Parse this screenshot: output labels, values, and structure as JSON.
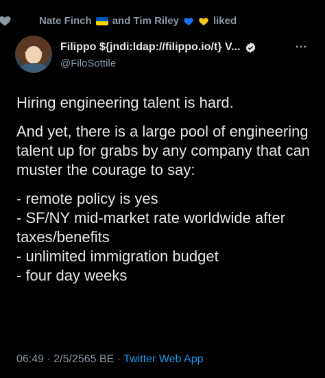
{
  "social_context": {
    "name1": "Nate Finch",
    "connector": "and Tim Riley",
    "suffix": "liked"
  },
  "author": {
    "display_name": "Filippo ${jndi:ldap://filippo.io/t} V...",
    "handle": "@FiloSottile"
  },
  "tweet": {
    "paragraph1": "Hiring engineering talent is hard.",
    "paragraph2": "And yet, there is a large pool of engineering talent up for grabs by any company that can muster the courage to say:",
    "list": [
      "- remote policy is yes",
      "- SF/NY mid-market rate worldwide after taxes/benefits",
      "- unlimited immigration budget",
      "- four day weeks"
    ]
  },
  "meta": {
    "time": "06:49",
    "sep1": " · ",
    "date": "2/5/2565 BE",
    "sep2": " · ",
    "client": "Twitter Web App"
  },
  "colors": {
    "background": "#000000",
    "text": "#e7e9ea",
    "secondary": "#8b98a5",
    "link": "#1d9bf0"
  }
}
